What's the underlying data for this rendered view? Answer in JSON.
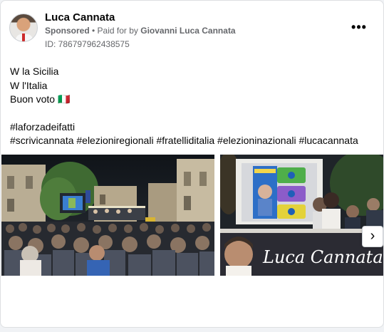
{
  "post": {
    "author": "Luca Cannata",
    "sponsored": "Sponsored",
    "paid_prefix": " • Paid for by ",
    "payer": "Giovanni Luca Cannata",
    "id_line": "ID: 786797962438575",
    "more_label": "•••",
    "text_lines": [
      "W la Sicilia",
      "W l'Italia",
      "Buon voto 🇮🇹"
    ],
    "hashtags_line1": "#laforzadeifatti",
    "hashtags_line2": "#scrivicannata #elezioniregionali #fratelliditalia #elezioninazionali #lucacannata"
  },
  "carousel": {
    "slide2_banner_text": "Luca Cannata",
    "next_label": "›"
  },
  "icons": {
    "more": "ellipsis-icon",
    "next": "chevron-right-icon"
  },
  "colors": {
    "secondary_text": "#65676b",
    "card_border": "#dddfe2",
    "banner_dark": "#2b2b33",
    "screen_blue": "#2d6fc7"
  }
}
